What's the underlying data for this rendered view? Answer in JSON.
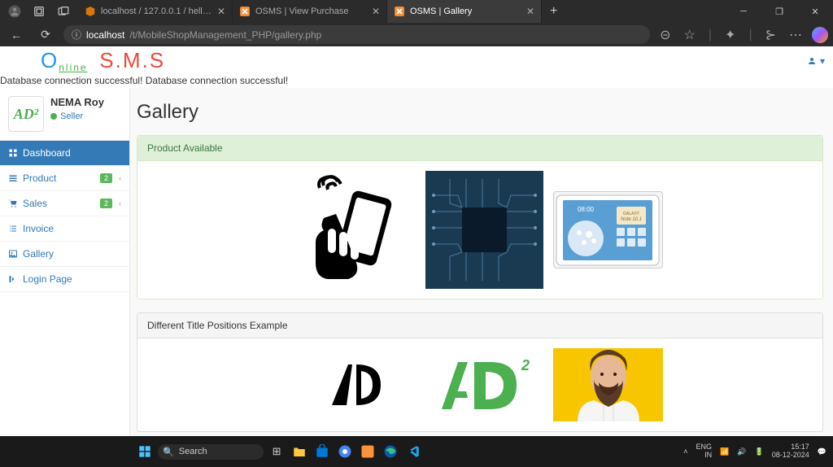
{
  "browser": {
    "tabs": [
      {
        "title": "localhost / 127.0.0.1 / hellophone"
      },
      {
        "title": "OSMS | View Purchase"
      },
      {
        "title": "OSMS | Gallery"
      }
    ],
    "url_host": "localhost",
    "url_path": "/t/MobileShopManagement_PHP/gallery.php"
  },
  "brand": {
    "o_text": "O",
    "nline_text": "nline",
    "sms_text": "S.M.S"
  },
  "db_message": "Database connection successful! Database connection successful!",
  "profile": {
    "name": "NEMA Roy",
    "role": "Seller",
    "logo_text": "AD²"
  },
  "sidebar": {
    "items": [
      {
        "label": "Dashboard",
        "icon": "dashboard"
      },
      {
        "label": "Product",
        "icon": "grid",
        "badge": "2"
      },
      {
        "label": "Sales",
        "icon": "cart",
        "badge": "2"
      },
      {
        "label": "Invoice",
        "icon": "list"
      },
      {
        "label": "Gallery",
        "icon": "image"
      },
      {
        "label": "Login Page",
        "icon": "arrow"
      }
    ]
  },
  "page_title": "Gallery",
  "panel1": {
    "title": "Product Available"
  },
  "panel2": {
    "title": "Different Title Positions Example"
  },
  "taskbar": {
    "search_placeholder": "Search",
    "lang": "ENG",
    "region": "IN",
    "time": "15:17",
    "date": "08-12-2024"
  }
}
